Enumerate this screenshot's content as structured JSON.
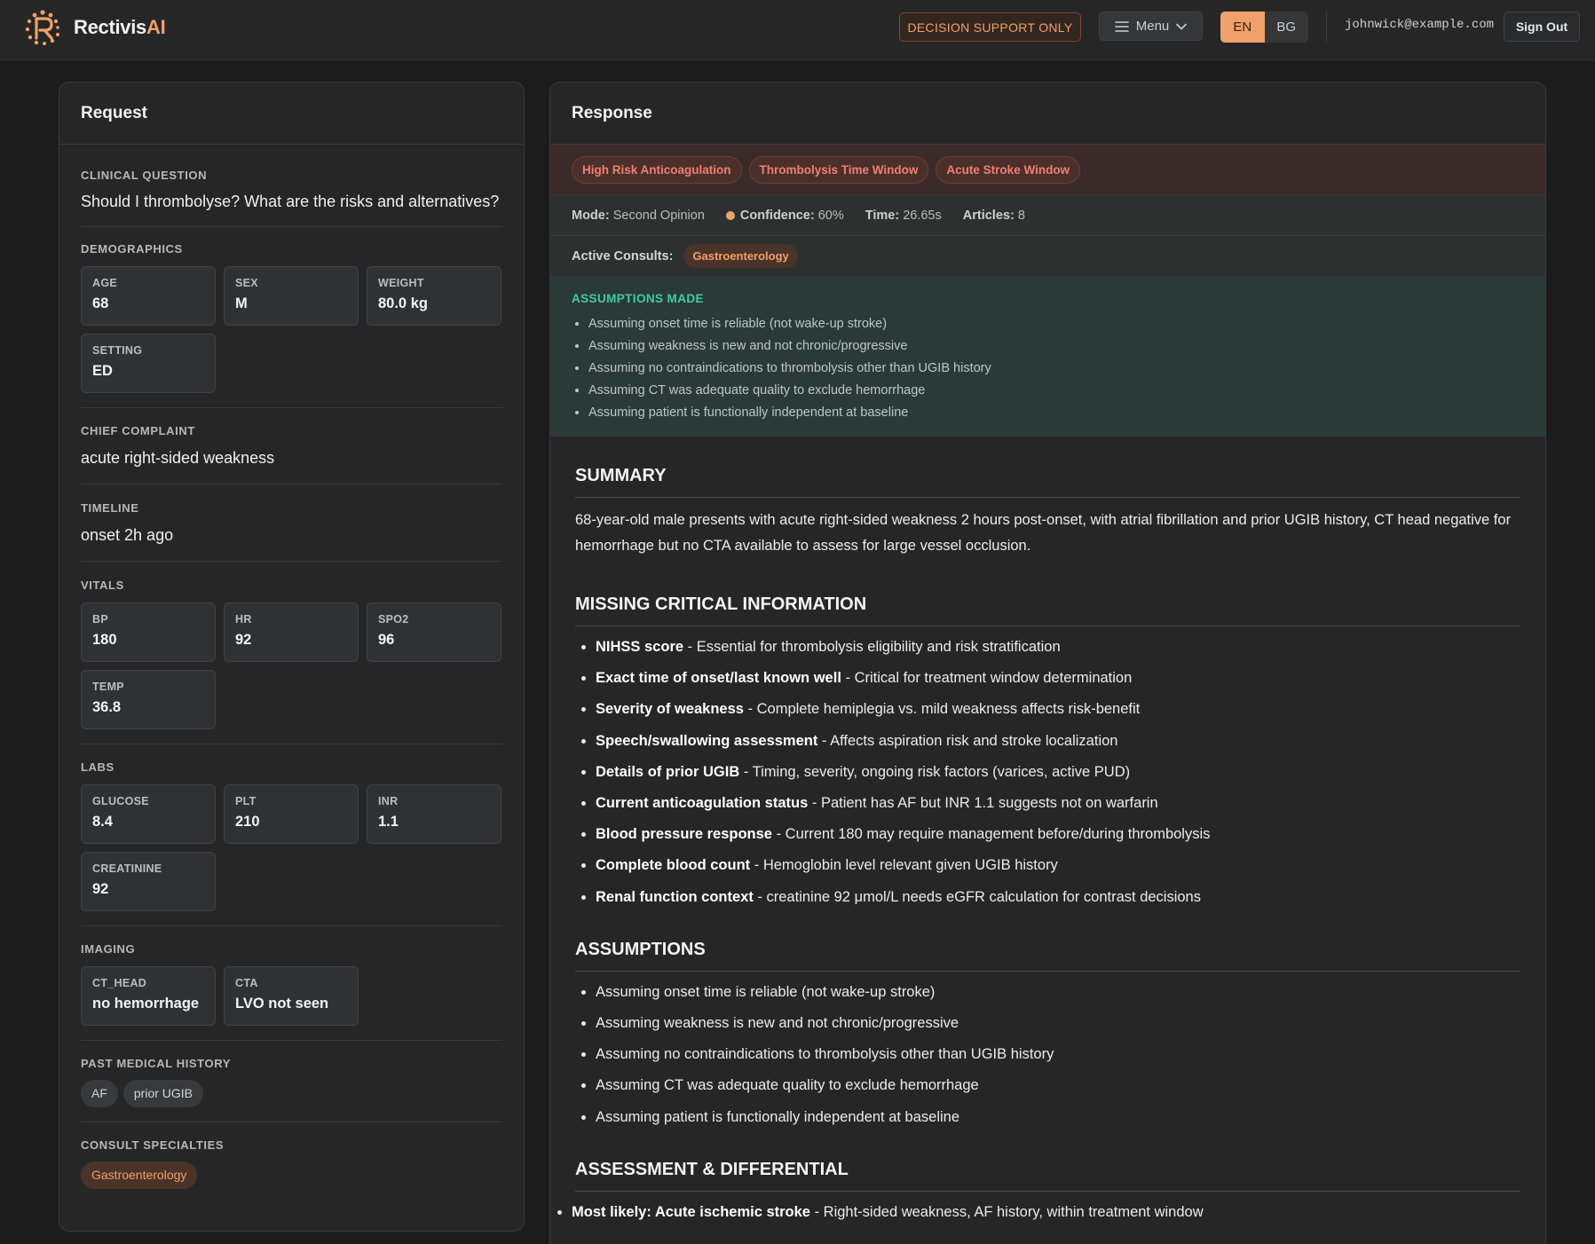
{
  "header": {
    "brand_main": "Rectivis",
    "brand_ai": "AI",
    "decision_badge": "DECISION SUPPORT ONLY",
    "menu_label": "Menu",
    "lang_en": "EN",
    "lang_bg": "BG",
    "email": "johnwick@example.com",
    "signout": "Sign Out",
    "accent_color": "#f0a06a"
  },
  "request": {
    "title": "Request",
    "clinical_question_label": "CLINICAL QUESTION",
    "clinical_question": "Should I thrombolyse? What are the risks and alternatives?",
    "demographics_label": "DEMOGRAPHICS",
    "demographics": [
      {
        "k": "AGE",
        "v": "68"
      },
      {
        "k": "SEX",
        "v": "M"
      },
      {
        "k": "WEIGHT",
        "v": "80.0 kg"
      },
      {
        "k": "SETTING",
        "v": "ED"
      }
    ],
    "chief_complaint_label": "CHIEF COMPLAINT",
    "chief_complaint": "acute right-sided weakness",
    "timeline_label": "TIMELINE",
    "timeline": "onset 2h ago",
    "vitals_label": "VITALS",
    "vitals": [
      {
        "k": "BP",
        "v": "180"
      },
      {
        "k": "HR",
        "v": "92"
      },
      {
        "k": "SPO2",
        "v": "96"
      },
      {
        "k": "TEMP",
        "v": "36.8"
      }
    ],
    "labs_label": "LABS",
    "labs": [
      {
        "k": "GLUCOSE",
        "v": "8.4"
      },
      {
        "k": "PLT",
        "v": "210"
      },
      {
        "k": "INR",
        "v": "1.1"
      },
      {
        "k": "CREATININE",
        "v": "92"
      }
    ],
    "imaging_label": "IMAGING",
    "imaging": [
      {
        "k": "CT_HEAD",
        "v": "no hemorrhage"
      },
      {
        "k": "CTA",
        "v": "LVO not seen"
      }
    ],
    "pmh_label": "PAST MEDICAL HISTORY",
    "pmh": [
      "AF",
      "prior UGIB"
    ],
    "consult_label": "CONSULT SPECIALTIES",
    "consults": [
      "Gastroenterology"
    ]
  },
  "response": {
    "title": "Response",
    "tags": [
      "High Risk Anticoagulation",
      "Thrombolysis Time Window",
      "Acute Stroke Window"
    ],
    "mode_label": "Mode:",
    "mode": "Second Opinion",
    "confidence_label": "Confidence:",
    "confidence": "60%",
    "time_label": "Time:",
    "time": "26.65s",
    "articles_label": "Articles:",
    "articles": "8",
    "active_consults_label": "Active Consults:",
    "active_consult": "Gastroenterology",
    "assumptions_made_title": "ASSUMPTIONS MADE",
    "assumptions_made": [
      "Assuming onset time is reliable (not wake-up stroke)",
      "Assuming weakness is new and not chronic/progressive",
      "Assuming no contraindications to thrombolysis other than UGIB history",
      "Assuming CT was adequate quality to exclude hemorrhage",
      "Assuming patient is functionally independent at baseline"
    ],
    "summary_title": "SUMMARY",
    "summary": "68-year-old male presents with acute right-sided weakness 2 hours post-onset, with atrial fibrillation and prior UGIB history, CT head negative for hemorrhage but no CTA available to assess for large vessel occlusion.",
    "missing_title": "MISSING CRITICAL INFORMATION",
    "missing": [
      {
        "b": "NIHSS score",
        "t": " - Essential for thrombolysis eligibility and risk stratification"
      },
      {
        "b": "Exact time of onset/last known well",
        "t": " - Critical for treatment window determination"
      },
      {
        "b": "Severity of weakness",
        "t": " - Complete hemiplegia vs. mild weakness affects risk-benefit"
      },
      {
        "b": "Speech/swallowing assessment",
        "t": " - Affects aspiration risk and stroke localization"
      },
      {
        "b": "Details of prior UGIB",
        "t": " - Timing, severity, ongoing risk factors (varices, active PUD)"
      },
      {
        "b": "Current anticoagulation status",
        "t": " - Patient has AF but INR 1.1 suggests not on warfarin"
      },
      {
        "b": "Blood pressure response",
        "t": " - Current 180 may require management before/during thrombolysis"
      },
      {
        "b": "Complete blood count",
        "t": " - Hemoglobin level relevant given UGIB history"
      },
      {
        "b": "Renal function context",
        "t": " - creatinine 92 μmol/L needs eGFR calculation for contrast decisions"
      }
    ],
    "assumptions_title": "ASSUMPTIONS",
    "assumptions": [
      "Assuming onset time is reliable (not wake-up stroke)",
      "Assuming weakness is new and not chronic/progressive",
      "Assuming no contraindications to thrombolysis other than UGIB history",
      "Assuming CT was adequate quality to exclude hemorrhage",
      "Assuming patient is functionally independent at baseline"
    ],
    "assessment_title": "ASSESSMENT & DIFFERENTIAL",
    "assessment": [
      {
        "b": "Most likely: Acute ischemic stroke",
        "t": " - Right-sided weakness, AF history, within treatment window"
      }
    ]
  }
}
